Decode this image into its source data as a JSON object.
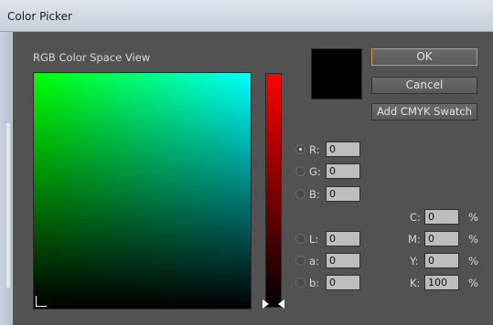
{
  "window": {
    "title": "Color Picker"
  },
  "picker": {
    "section_label": "RGB Color Space View",
    "current_color": "#000000"
  },
  "buttons": {
    "ok": "OK",
    "cancel": "Cancel",
    "add_cmyk": "Add CMYK Swatch"
  },
  "rgb": [
    {
      "label": "R:",
      "value": "0",
      "selected": true
    },
    {
      "label": "G:",
      "value": "0",
      "selected": false
    },
    {
      "label": "B:",
      "value": "0",
      "selected": false
    }
  ],
  "lab": [
    {
      "label": "L:",
      "value": "0",
      "selected": false
    },
    {
      "label": "a:",
      "value": "0",
      "selected": false
    },
    {
      "label": "b:",
      "value": "0",
      "selected": false
    }
  ],
  "cmyk": [
    {
      "label": "C:",
      "value": "0",
      "unit": "%"
    },
    {
      "label": "M:",
      "value": "0",
      "unit": "%"
    },
    {
      "label": "Y:",
      "value": "0",
      "unit": "%"
    },
    {
      "label": "K:",
      "value": "100",
      "unit": "%"
    }
  ],
  "colors": {
    "accent_ok_border": "#d99a3a",
    "panel_bg": "#525252"
  }
}
